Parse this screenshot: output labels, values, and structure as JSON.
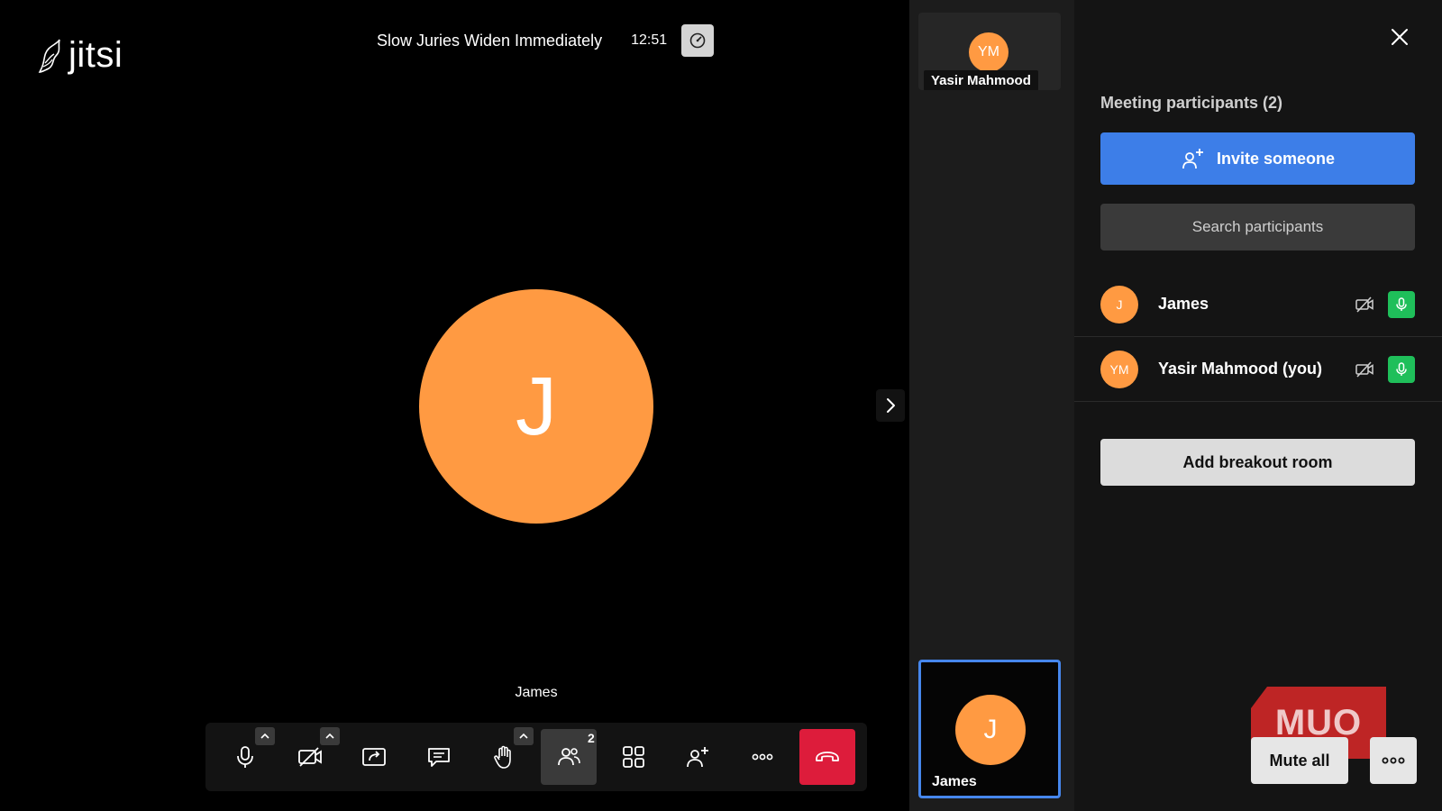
{
  "app": {
    "logo_text": "jitsi"
  },
  "header": {
    "meeting_title": "Slow Juries Widen Immediately",
    "time": "12:51",
    "speed_icon": "speedometer-icon"
  },
  "stage": {
    "main_avatar_initial": "J",
    "speaker_name": "James",
    "avatar_color": "#ff9a42"
  },
  "toolbar": {
    "buttons": [
      {
        "name": "microphone",
        "icon": "microphone-icon",
        "has_caret": true
      },
      {
        "name": "camera",
        "icon": "camera-off-icon",
        "has_caret": true
      },
      {
        "name": "share-screen",
        "icon": "share-screen-icon",
        "has_caret": false
      },
      {
        "name": "chat",
        "icon": "chat-icon",
        "has_caret": false
      },
      {
        "name": "raise-hand",
        "icon": "hand-icon",
        "has_caret": true
      },
      {
        "name": "participants",
        "icon": "participants-icon",
        "badge": "2",
        "active": true
      },
      {
        "name": "tile-view",
        "icon": "grid-icon"
      },
      {
        "name": "invite",
        "icon": "add-person-icon"
      },
      {
        "name": "more",
        "icon": "more-icon"
      },
      {
        "name": "leave",
        "icon": "hangup-icon",
        "color": "#dd1c3b"
      }
    ]
  },
  "filmstrip": {
    "top_thumb": {
      "initials": "YM",
      "name": "Yasir Mahmood"
    },
    "bottom_thumb": {
      "initial": "J",
      "name": "James",
      "highlight_color": "#4687ed"
    }
  },
  "participants_pane": {
    "title": "Meeting participants (2)",
    "invite_label": "Invite someone",
    "search_placeholder": "Search participants",
    "participants": [
      {
        "initials": "J",
        "name": "James"
      },
      {
        "initials": "YM",
        "name": "Yasir Mahmood (you)"
      }
    ],
    "breakout_label": "Add breakout room",
    "mute_all_label": "Mute all",
    "watermark": "MUO",
    "accent_color": "#3d7ee8",
    "mic_on_color": "#1fbf5a"
  }
}
